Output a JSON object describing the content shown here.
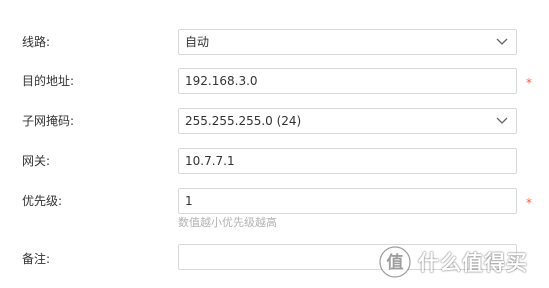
{
  "form": {
    "route": {
      "label": "线路:",
      "value": "自动"
    },
    "destination": {
      "label": "目的地址:",
      "value": "192.168.3.0",
      "required_mark": "*"
    },
    "subnet_mask": {
      "label": "子网掩码:",
      "value": "255.255.255.0 (24)"
    },
    "gateway": {
      "label": "网关:",
      "value": "10.7.7.1"
    },
    "priority": {
      "label": "优先级:",
      "value": "1",
      "required_mark": "*",
      "hint": "数值越小优先级越高"
    },
    "remark": {
      "label": "备注:",
      "value": ""
    }
  },
  "watermark": {
    "text": "什么值得买",
    "icon": "smzdm-logo-icon"
  },
  "colors": {
    "border": "#d9d9d9",
    "required": "#ff5a3c",
    "hint": "#b3b3b3",
    "text": "#333333"
  }
}
